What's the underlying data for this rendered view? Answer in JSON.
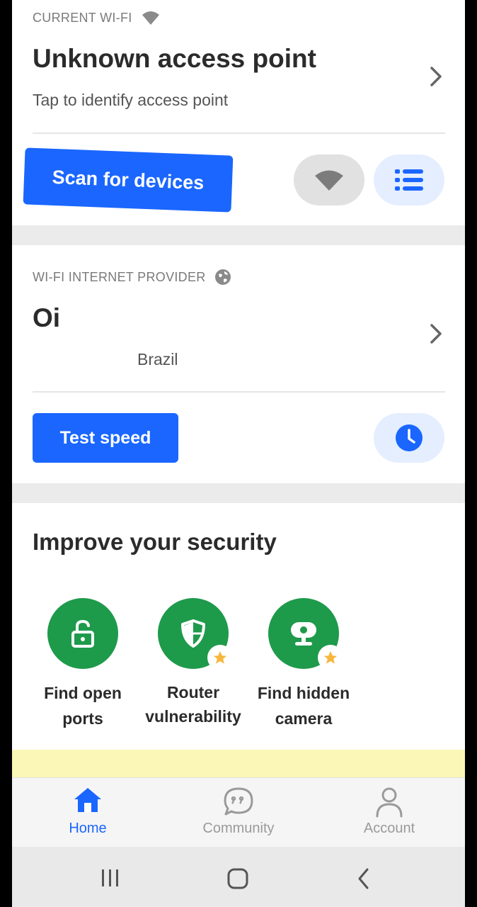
{
  "current_wifi": {
    "caption": "CURRENT WI-FI",
    "caption_icon": "wifi-icon",
    "title": "Unknown access point",
    "subtitle": "Tap to identify access point",
    "scan_button": "Scan for devices",
    "wifi_button_icon": "wifi-icon",
    "list_button_icon": "list-icon"
  },
  "provider": {
    "caption": "WI-FI INTERNET PROVIDER",
    "caption_icon": "globe-icon",
    "name": "Oi",
    "country": "Brazil",
    "speed_button": "Test speed",
    "history_icon": "clock-icon"
  },
  "security": {
    "heading": "Improve your security",
    "features": [
      {
        "line1": "Find open",
        "line2": "ports",
        "icon": "open-lock-icon",
        "premium": false
      },
      {
        "line1": "Router",
        "line2": "vulnerability",
        "icon": "shield-icon",
        "premium": true
      },
      {
        "line1": "Find hidden",
        "line2": "camera",
        "icon": "camera-icon",
        "premium": true
      }
    ]
  },
  "bottom_nav": {
    "items": [
      {
        "label": "Home",
        "icon": "home-icon",
        "active": true
      },
      {
        "label": "Community",
        "icon": "chat-icon",
        "active": false
      },
      {
        "label": "Account",
        "icon": "person-icon",
        "active": false
      }
    ]
  },
  "colors": {
    "primary": "#1a66ff",
    "feature_green": "#1e9a4b",
    "star": "#f6b73c",
    "banner": "#fbf7b6"
  }
}
